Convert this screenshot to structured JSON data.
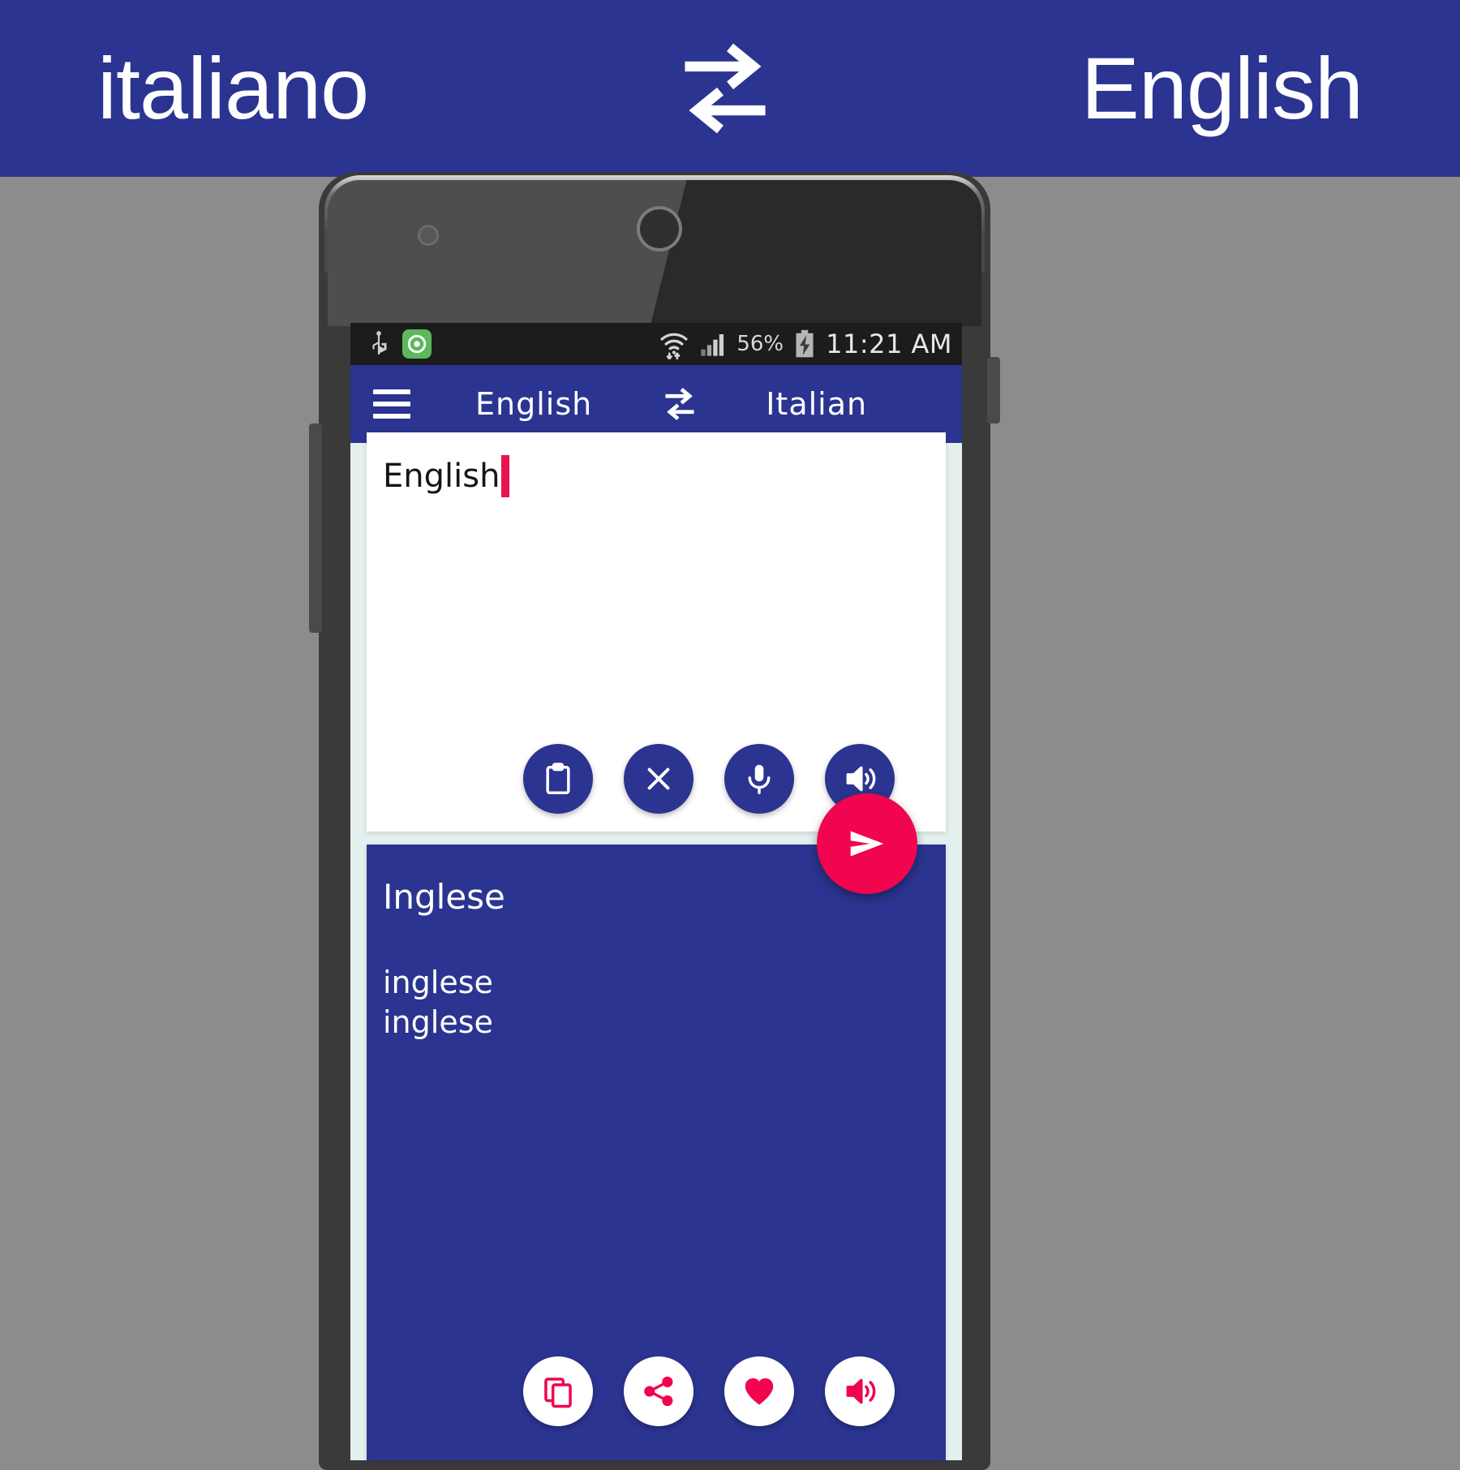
{
  "promo_banner": {
    "left_language": "italiano",
    "swap_icon": "swap-repeat-icon",
    "right_language": "English",
    "background_color": "#2b3490",
    "text_color": "#ffffff"
  },
  "phone": {
    "status_bar": {
      "usb_icon": "usb-icon",
      "app_icon": "app-notification-icon",
      "wifi_icon": "wifi-icon",
      "signal_icon": "cellular-signal-icon",
      "battery_percent": "56%",
      "battery_icon": "battery-charging-icon",
      "time": "11:21 AM",
      "background_color": "#1c1c1c"
    },
    "toolbar": {
      "menu_icon": "hamburger-menu-icon",
      "source_language": "English",
      "swap_icon": "swap-repeat-icon",
      "target_language": "Italian",
      "background_color": "#2b3490"
    },
    "source_panel": {
      "text": "English",
      "caret_color": "#e8134f",
      "background_color": "#ffffff",
      "actions": [
        {
          "name": "paste-button",
          "icon": "clipboard-icon",
          "label": "Paste"
        },
        {
          "name": "clear-button",
          "icon": "close-x-icon",
          "label": "Clear"
        },
        {
          "name": "voice-input-button",
          "icon": "microphone-icon",
          "label": "Speak"
        },
        {
          "name": "listen-source-button",
          "icon": "speaker-icon",
          "label": "Listen"
        }
      ]
    },
    "send_button": {
      "name": "translate-send-button",
      "icon": "send-icon",
      "color": "#f0054e"
    },
    "result_panel": {
      "main_translation": "Inglese",
      "alternatives": [
        "inglese",
        "inglese"
      ],
      "background_color": "#2b3490",
      "actions": [
        {
          "name": "copy-button",
          "icon": "copy-icon",
          "label": "Copy"
        },
        {
          "name": "share-button",
          "icon": "share-icon",
          "label": "Share"
        },
        {
          "name": "favorite-button",
          "icon": "heart-icon",
          "label": "Favorite"
        },
        {
          "name": "listen-result-button",
          "icon": "speaker-icon",
          "label": "Listen"
        }
      ]
    }
  }
}
